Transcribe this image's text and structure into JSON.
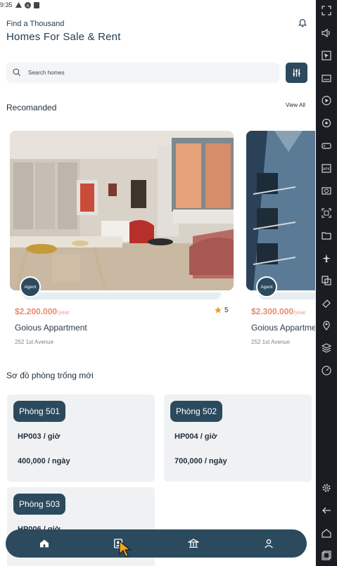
{
  "status": {
    "time": "9:35"
  },
  "header": {
    "subtitle": "Find a Thousand",
    "title": "Homes For Sale & Rent"
  },
  "search": {
    "placeholder": "Search homes"
  },
  "recommended": {
    "heading": "Recomanded",
    "view_all": "View All",
    "cards": [
      {
        "agent": "Agent",
        "price": "$2.200.000",
        "period": "/year",
        "rating": "5",
        "name": "Goious Appartment",
        "address": "252 1st Avenue"
      },
      {
        "agent": "Agent",
        "price": "$2.300.000",
        "period": "/year",
        "rating": "",
        "name": "Goious Appartment",
        "address": "252 1st Avenue"
      }
    ]
  },
  "rooms": {
    "heading": "Sơ đồ phòng trống mới",
    "items": [
      {
        "name": "Phòng 501",
        "code": "HP003 / giờ",
        "rate": "400,000 / ngày"
      },
      {
        "name": "Phòng 502",
        "code": "HP004 / giờ",
        "rate": "700,000 / ngày"
      },
      {
        "name": "Phòng 503",
        "code": "HP006 / giờ",
        "rate": ""
      }
    ]
  },
  "colors": {
    "primary": "#2b4a5e",
    "price": "#e8896e",
    "star": "#f29a2e",
    "sidebar": "#1a1c22"
  },
  "bottom_nav": [
    "home-icon",
    "contacts-icon",
    "bank-icon",
    "profile-icon"
  ],
  "emulator_sidebar": [
    "fullscreen-icon",
    "volume-icon",
    "pointer-icon",
    "keyboard-icon",
    "play-icon",
    "location-target-icon",
    "gamepad-icon",
    "apk-icon",
    "screenshot-icon",
    "record-icon",
    "folder-icon",
    "airplane-icon",
    "copy-icon",
    "erase-icon",
    "map-pin-icon",
    "layers-icon",
    "speed-icon",
    "settings-icon",
    "back-icon",
    "home-icon",
    "recents-icon"
  ]
}
